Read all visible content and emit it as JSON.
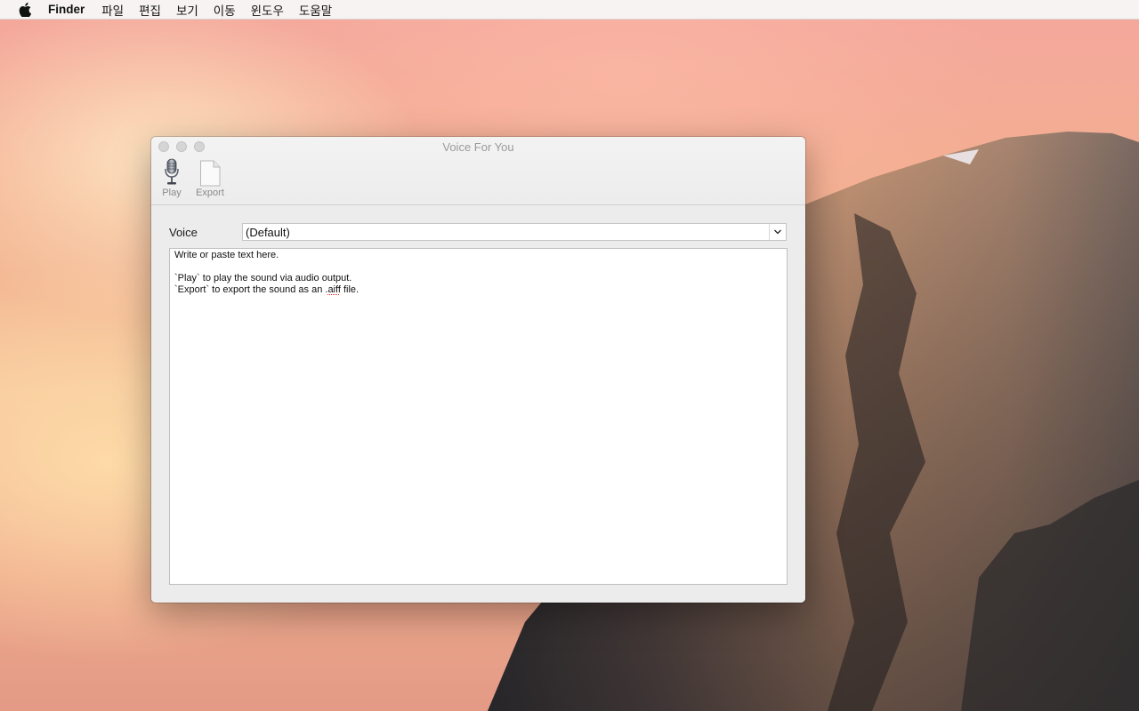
{
  "menubar": {
    "apple_icon": "apple-logo-icon",
    "app_name": "Finder",
    "items": [
      "파일",
      "편집",
      "보기",
      "이동",
      "윈도우",
      "도움말"
    ]
  },
  "window": {
    "title": "Voice For You",
    "toolbar": {
      "play_label": "Play",
      "play_icon": "microphone-icon",
      "export_label": "Export",
      "export_icon": "document-icon"
    },
    "voice": {
      "label": "Voice",
      "selected": "(Default)"
    },
    "text": {
      "line1": "Write or paste text here.",
      "line2": "`Play` to play the sound via audio output.",
      "line3_prefix": "`Export` to export the sound as an .",
      "line3_misspelled": "aiff",
      "line3_suffix": " file."
    }
  },
  "colors": {
    "menubar_bg": "#f6f6f6",
    "window_bg": "#ececec",
    "title_text": "#9a9a9a",
    "spellcheck": "#e02020"
  }
}
